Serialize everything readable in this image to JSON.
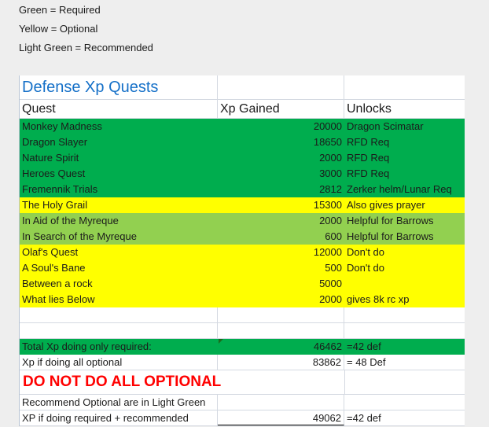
{
  "legend": {
    "required": "Green = Required",
    "optional": "Yellow = Optional",
    "recommended": "Light Green = Recommended"
  },
  "colors": {
    "required": "#00ad4e",
    "optional": "#ffff00",
    "recommended": "#92d050",
    "title": "#1570c8",
    "warning": "#ff0000"
  },
  "sheet": {
    "title": "Defense Xp Quests",
    "headers": {
      "quest": "Quest",
      "xp": "Xp Gained",
      "unlocks": "Unlocks"
    },
    "rows": [
      {
        "quest": "Monkey Madness",
        "xp": "20000",
        "unlocks": "Dragon Scimatar",
        "category": "required"
      },
      {
        "quest": "Dragon Slayer",
        "xp": "18650",
        "unlocks": "RFD Req",
        "category": "required"
      },
      {
        "quest": "Nature Spirit",
        "xp": "2000",
        "unlocks": "RFD Req",
        "category": "required"
      },
      {
        "quest": "Heroes Quest",
        "xp": "3000",
        "unlocks": "RFD Req",
        "category": "required"
      },
      {
        "quest": "Fremennik Trials",
        "xp": "2812",
        "unlocks": "Zerker helm/Lunar Req",
        "category": "required"
      },
      {
        "quest": "The Holy Grail",
        "xp": "15300",
        "unlocks": "Also gives prayer",
        "category": "optional"
      },
      {
        "quest": "In Aid of the Myreque",
        "xp": "2000",
        "unlocks": "Helpful for Barrows",
        "category": "recommended"
      },
      {
        "quest": "In Search of the Myreque",
        "xp": "600",
        "unlocks": "Helpful for Barrows",
        "category": "recommended"
      },
      {
        "quest": "Olaf's Quest",
        "xp": "12000",
        "unlocks": "Don't do",
        "category": "optional"
      },
      {
        "quest": "A Soul's Bane",
        "xp": "500",
        "unlocks": "Don't do",
        "category": "optional"
      },
      {
        "quest": "Between a rock",
        "xp": "5000",
        "unlocks": "",
        "category": "optional"
      },
      {
        "quest": "What lies Below",
        "xp": "2000",
        "unlocks": "gives 8k rc xp",
        "category": "optional"
      }
    ],
    "summary": {
      "required_label": "Total Xp doing only required:",
      "required_xp": "46462",
      "required_level": "=42 def",
      "all_optional_label": "Xp if doing all optional",
      "all_optional_xp": "83862",
      "all_optional_level": "= 48 Def",
      "warning": "DO NOT DO ALL OPTIONAL",
      "recommend_note": "Recommend Optional are in Light Green",
      "recommended_label": "XP if doing required + recommended",
      "recommended_xp": "49062",
      "recommended_level": "=42 def"
    }
  }
}
